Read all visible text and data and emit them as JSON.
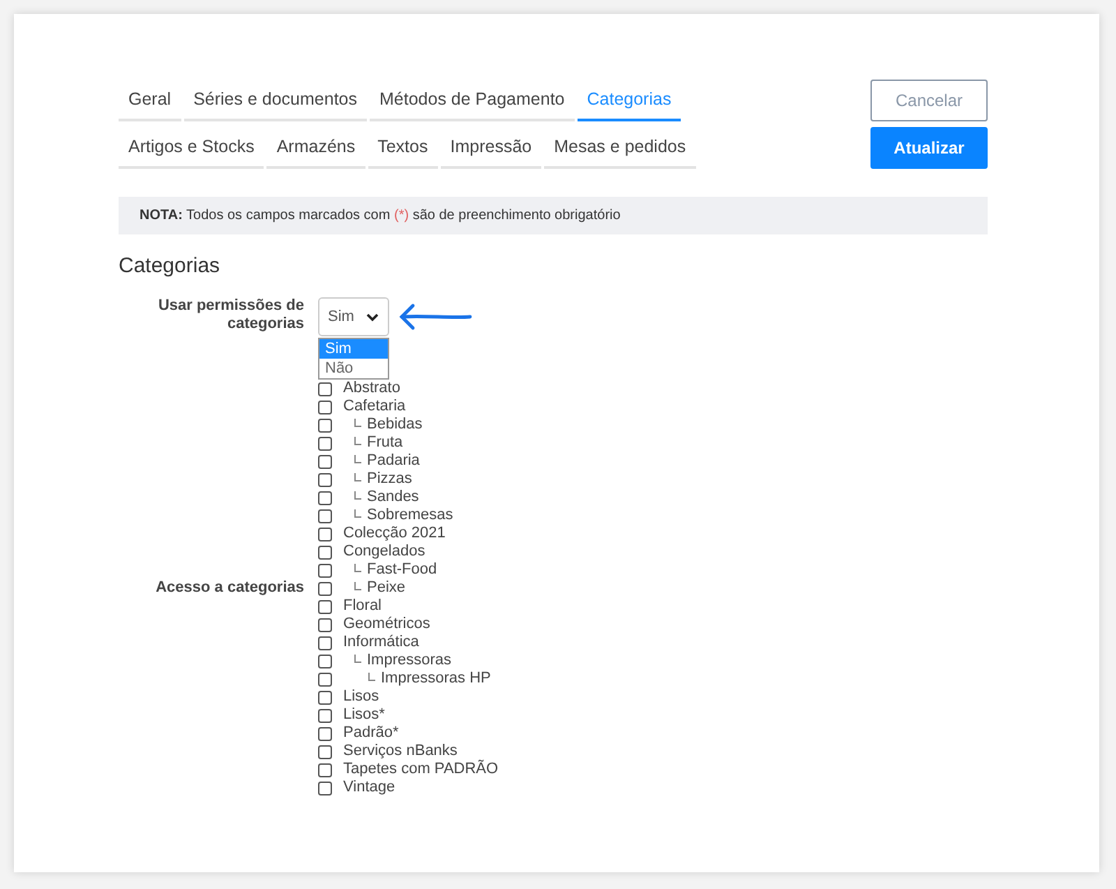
{
  "tabs": [
    {
      "label": "Geral",
      "selected": false
    },
    {
      "label": "Séries e documentos",
      "selected": false
    },
    {
      "label": "Métodos de Pagamento",
      "selected": false
    },
    {
      "label": "Categorias",
      "selected": true
    },
    {
      "label": "Artigos e Stocks",
      "selected": false
    },
    {
      "label": "Armazéns",
      "selected": false
    },
    {
      "label": "Textos",
      "selected": false
    },
    {
      "label": "Impressão",
      "selected": false
    },
    {
      "label": "Mesas e pedidos",
      "selected": false
    }
  ],
  "buttons": [
    {
      "label": "Cancelar",
      "kind": "secondary"
    },
    {
      "label": "Atualizar",
      "kind": "primary"
    }
  ],
  "note": {
    "prefix": "NOTA:",
    "before": "Todos os campos marcados com",
    "mark": "(*)",
    "after": "são de preenchimento obrigatório"
  },
  "section_title": "Categorias",
  "permission_field": {
    "label": "Usar permissões de categorias",
    "value": "Sim",
    "expanded": true,
    "options": [
      {
        "label": "Sim",
        "selected": true
      },
      {
        "label": "Não",
        "selected": false
      }
    ]
  },
  "access_field": {
    "label": "Acesso a categorias",
    "categories": [
      {
        "label": "Abstrato",
        "checked": false
      },
      {
        "label": "Cafetaria",
        "checked": false,
        "children": [
          {
            "label": "Bebidas",
            "checked": false
          },
          {
            "label": "Fruta",
            "checked": false
          },
          {
            "label": "Padaria",
            "checked": false
          },
          {
            "label": "Pizzas",
            "checked": false
          },
          {
            "label": "Sandes",
            "checked": false
          },
          {
            "label": "Sobremesas",
            "checked": false
          }
        ]
      },
      {
        "label": "Colecção 2021",
        "checked": false
      },
      {
        "label": "Congelados",
        "checked": false,
        "children": [
          {
            "label": "Fast-Food",
            "checked": false
          },
          {
            "label": "Peixe",
            "checked": false
          }
        ]
      },
      {
        "label": "Floral",
        "checked": false
      },
      {
        "label": "Geométricos",
        "checked": false
      },
      {
        "label": "Informática",
        "checked": false,
        "children": [
          {
            "label": "Impressoras",
            "checked": false,
            "children": [
              {
                "label": "Impressoras HP",
                "checked": false
              }
            ]
          }
        ]
      },
      {
        "label": "Lisos",
        "checked": false
      },
      {
        "label": "Lisos*",
        "checked": false
      },
      {
        "label": "Padrão*",
        "checked": false
      },
      {
        "label": "Serviços nBanks",
        "checked": false
      },
      {
        "label": "Tapetes com PADRÃO",
        "checked": false
      },
      {
        "label": "Vintage",
        "checked": false
      }
    ]
  }
}
